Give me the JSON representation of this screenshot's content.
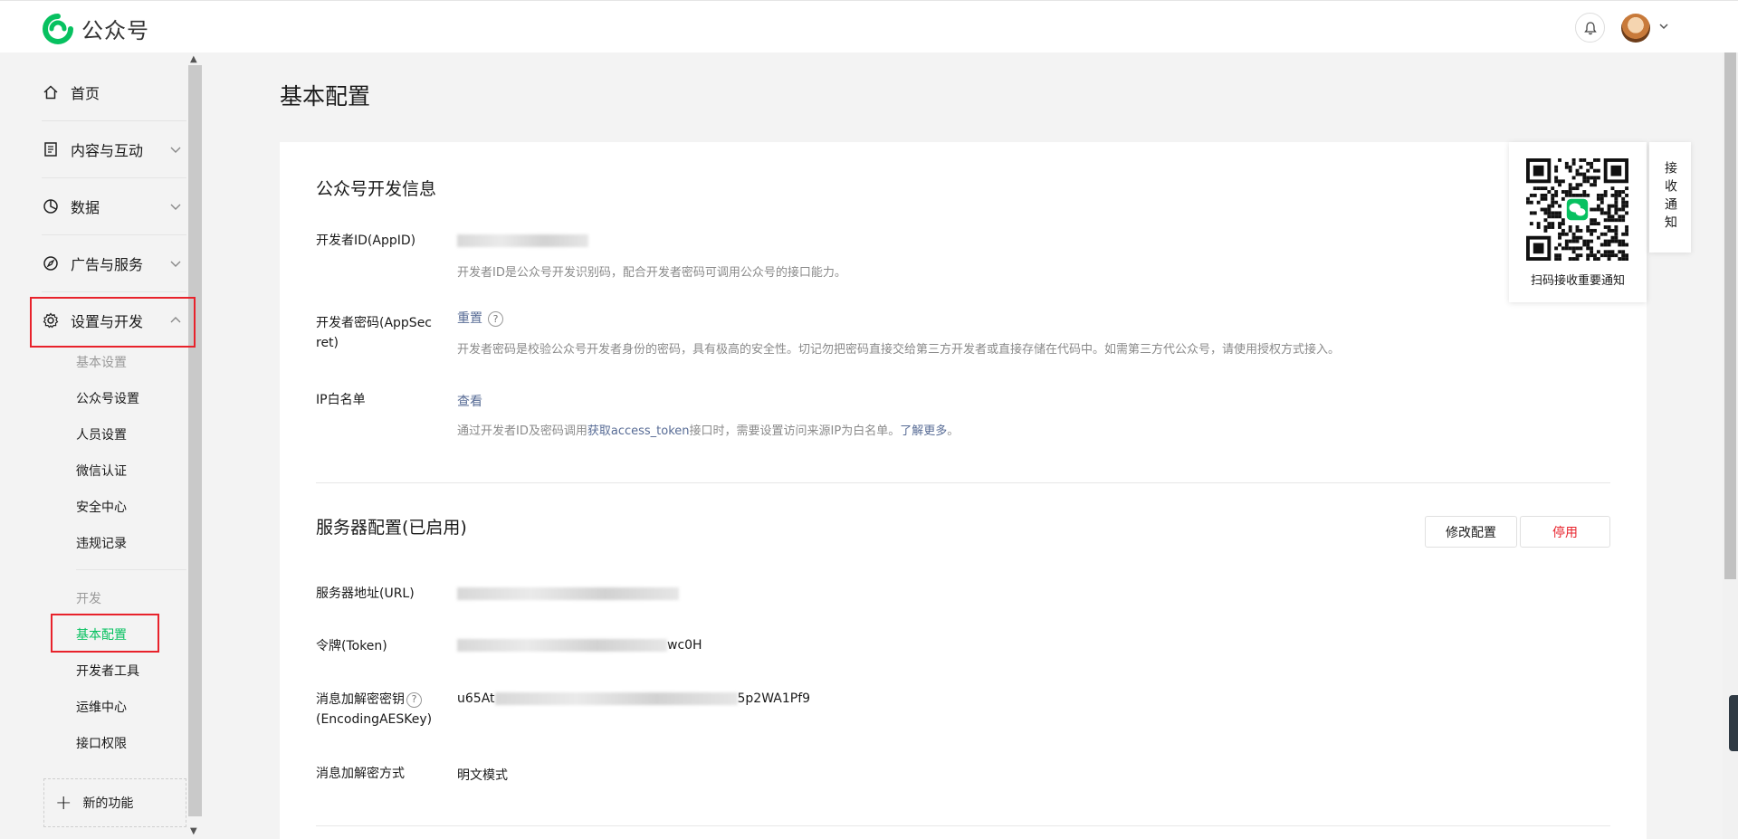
{
  "header": {
    "logo_text": "公众号"
  },
  "sidebar": {
    "items": [
      {
        "label": "首页"
      },
      {
        "label": "内容与互动"
      },
      {
        "label": "数据"
      },
      {
        "label": "广告与服务"
      },
      {
        "label": "设置与开发"
      }
    ],
    "settings_sub": [
      "基本设置",
      "公众号设置",
      "人员设置",
      "微信认证",
      "安全中心",
      "违规记录"
    ],
    "dev_label": "开发",
    "dev_sub": [
      "基本配置",
      "开发者工具",
      "运维中心",
      "接口权限"
    ],
    "new_feature": "新的功能"
  },
  "page": {
    "title": "基本配置"
  },
  "dev_info": {
    "title": "公众号开发信息",
    "appid_label": "开发者ID(AppID)",
    "appid_desc": "开发者ID是公众号开发识别码，配合开发者密码可调用公众号的接口能力。",
    "secret_label_1": "开发者密码(AppSec",
    "secret_label_2": "ret)",
    "secret_action": "重置",
    "secret_desc": "开发者密码是校验公众号开发者身份的密码，具有极高的安全性。切记勿把密码直接交给第三方开发者或直接存储在代码中。如需第三方代公众号，请使用授权方式接入。",
    "ip_label": "IP白名单",
    "ip_action": "查看",
    "ip_desc_1": "通过开发者ID及密码调用",
    "ip_desc_link": "获取access_token",
    "ip_desc_2": "接口时，需要设置访问来源IP为白名单。",
    "ip_desc_more": "了解更多",
    "ip_desc_end": "。"
  },
  "server": {
    "title": "服务器配置(已启用)",
    "edit_button": "修改配置",
    "disable_button": "停用",
    "url_label": "服务器地址(URL)",
    "token_label": "令牌(Token)",
    "token_suffix": "wc0H",
    "aes_label_1": "消息加解密密钥",
    "aes_label_2": "(EncodingAESKey)",
    "aes_prefix": "u65At",
    "aes_suffix": "5p2WA1Pf9",
    "mode_label": "消息加解密方式",
    "mode_value": "明文模式"
  },
  "qr": {
    "caption": "扫码接收重要通知",
    "tab": "接收通知"
  },
  "colors": {
    "brand_green": "#07c160",
    "link_blue": "#576b95",
    "danger_red": "#e8222b",
    "highlight_box": "#e8222b"
  }
}
